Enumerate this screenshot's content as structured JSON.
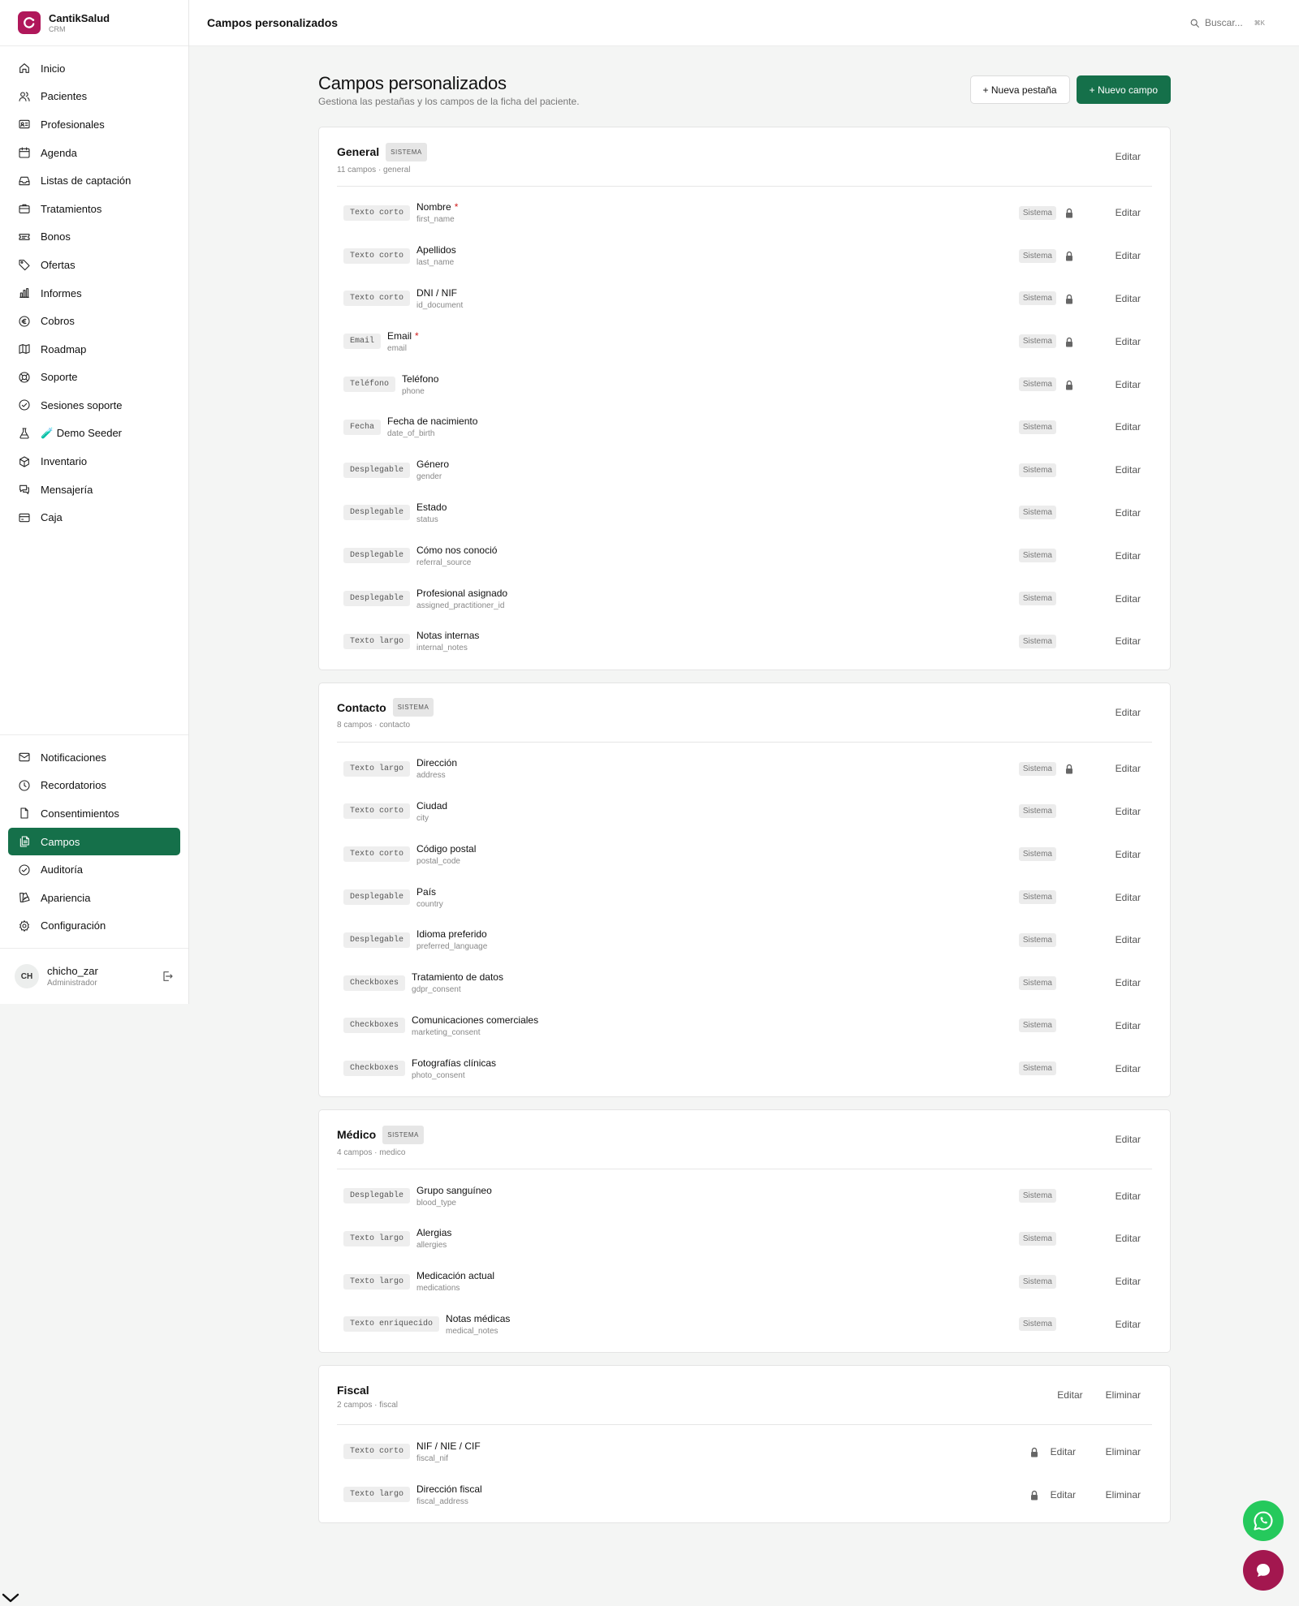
{
  "brand": {
    "name": "CantikSalud",
    "sub": "CRM"
  },
  "nav_main": [
    {
      "id": "inicio",
      "label": "Inicio",
      "icon": "home-icon"
    },
    {
      "id": "pacientes",
      "label": "Pacientes",
      "icon": "users-icon"
    },
    {
      "id": "profesionales",
      "label": "Profesionales",
      "icon": "id-card-icon"
    },
    {
      "id": "agenda",
      "label": "Agenda",
      "icon": "calendar-icon"
    },
    {
      "id": "listas",
      "label": "Listas de captación",
      "icon": "inbox-icon"
    },
    {
      "id": "tratamientos",
      "label": "Tratamientos",
      "icon": "briefcase-icon"
    },
    {
      "id": "bonos",
      "label": "Bonos",
      "icon": "ticket-icon"
    },
    {
      "id": "ofertas",
      "label": "Ofertas",
      "icon": "tag-icon"
    },
    {
      "id": "informes",
      "label": "Informes",
      "icon": "bar-chart-icon"
    },
    {
      "id": "cobros",
      "label": "Cobros",
      "icon": "euro-icon"
    },
    {
      "id": "roadmap",
      "label": "Roadmap",
      "icon": "map-icon"
    },
    {
      "id": "soporte",
      "label": "Soporte",
      "icon": "lifebuoy-icon"
    },
    {
      "id": "sesiones",
      "label": "Sesiones soporte",
      "icon": "shield-check-icon"
    },
    {
      "id": "demo",
      "label": "🧪 Demo Seeder",
      "icon": "flask-icon"
    },
    {
      "id": "inventario",
      "label": "Inventario",
      "icon": "box-icon"
    },
    {
      "id": "mensajeria",
      "label": "Mensajería",
      "icon": "message-icon"
    },
    {
      "id": "caja",
      "label": "Caja",
      "icon": "cash-register-icon"
    }
  ],
  "nav_bottom": [
    {
      "id": "notificaciones",
      "label": "Notificaciones",
      "icon": "mail-icon"
    },
    {
      "id": "recordatorios",
      "label": "Recordatorios",
      "icon": "clock-icon"
    },
    {
      "id": "consentimientos",
      "label": "Consentimientos",
      "icon": "file-icon"
    },
    {
      "id": "campos",
      "label": "Campos",
      "icon": "files-icon",
      "active": true
    },
    {
      "id": "auditoria",
      "label": "Auditoría",
      "icon": "shield-check-icon"
    },
    {
      "id": "apariencia",
      "label": "Apariencia",
      "icon": "palette-icon"
    },
    {
      "id": "configuracion",
      "label": "Configuración",
      "icon": "gear-icon"
    }
  ],
  "user": {
    "initials": "CH",
    "name": "chicho_zar",
    "role": "Administrador"
  },
  "header": {
    "title": "Campos personalizados",
    "search_placeholder": "Buscar...",
    "shortcut": "⌘K"
  },
  "page": {
    "title": "Campos personalizados",
    "subtitle": "Gestiona las pestañas y los campos de la ficha del paciente.",
    "new_tab_button": "+ Nueva pestaña",
    "new_field_button": "+ Nuevo campo"
  },
  "labels": {
    "edit": "Editar",
    "delete": "Eliminar",
    "system_badge": "SISTEMA",
    "system_chip": "Sistema"
  },
  "sections": [
    {
      "title": "General",
      "system": true,
      "meta": "11 campos · general",
      "fields": [
        {
          "type": "Texto corto",
          "label": "Nombre",
          "key": "first_name",
          "required": true,
          "system": true,
          "locked": true
        },
        {
          "type": "Texto corto",
          "label": "Apellidos",
          "key": "last_name",
          "required": false,
          "system": true,
          "locked": true
        },
        {
          "type": "Texto corto",
          "label": "DNI / NIF",
          "key": "id_document",
          "required": false,
          "system": true,
          "locked": true
        },
        {
          "type": "Email",
          "label": "Email",
          "key": "email",
          "required": true,
          "system": true,
          "locked": true
        },
        {
          "type": "Teléfono",
          "label": "Teléfono",
          "key": "phone",
          "required": false,
          "system": true,
          "locked": true
        },
        {
          "type": "Fecha",
          "label": "Fecha de nacimiento",
          "key": "date_of_birth",
          "required": false,
          "system": true,
          "locked": false
        },
        {
          "type": "Desplegable",
          "label": "Género",
          "key": "gender",
          "required": false,
          "system": true,
          "locked": false
        },
        {
          "type": "Desplegable",
          "label": "Estado",
          "key": "status",
          "required": false,
          "system": true,
          "locked": false
        },
        {
          "type": "Desplegable",
          "label": "Cómo nos conoció",
          "key": "referral_source",
          "required": false,
          "system": true,
          "locked": false
        },
        {
          "type": "Desplegable",
          "label": "Profesional asignado",
          "key": "assigned_practitioner_id",
          "required": false,
          "system": true,
          "locked": false
        },
        {
          "type": "Texto largo",
          "label": "Notas internas",
          "key": "internal_notes",
          "required": false,
          "system": true,
          "locked": false
        }
      ]
    },
    {
      "title": "Contacto",
      "system": true,
      "meta": "8 campos · contacto",
      "fields": [
        {
          "type": "Texto largo",
          "label": "Dirección",
          "key": "address",
          "required": false,
          "system": true,
          "locked": true
        },
        {
          "type": "Texto corto",
          "label": "Ciudad",
          "key": "city",
          "required": false,
          "system": true,
          "locked": false
        },
        {
          "type": "Texto corto",
          "label": "Código postal",
          "key": "postal_code",
          "required": false,
          "system": true,
          "locked": false
        },
        {
          "type": "Desplegable",
          "label": "País",
          "key": "country",
          "required": false,
          "system": true,
          "locked": false
        },
        {
          "type": "Desplegable",
          "label": "Idioma preferido",
          "key": "preferred_language",
          "required": false,
          "system": true,
          "locked": false
        },
        {
          "type": "Checkboxes",
          "label": "Tratamiento de datos",
          "key": "gdpr_consent",
          "required": false,
          "system": true,
          "locked": false
        },
        {
          "type": "Checkboxes",
          "label": "Comunicaciones comerciales",
          "key": "marketing_consent",
          "required": false,
          "system": true,
          "locked": false
        },
        {
          "type": "Checkboxes",
          "label": "Fotografías clínicas",
          "key": "photo_consent",
          "required": false,
          "system": true,
          "locked": false
        }
      ]
    },
    {
      "title": "Médico",
      "system": true,
      "meta": "4 campos · medico",
      "fields": [
        {
          "type": "Desplegable",
          "label": "Grupo sanguíneo",
          "key": "blood_type",
          "required": false,
          "system": true,
          "locked": false
        },
        {
          "type": "Texto largo",
          "label": "Alergias",
          "key": "allergies",
          "required": false,
          "system": true,
          "locked": false
        },
        {
          "type": "Texto largo",
          "label": "Medicación actual",
          "key": "medications",
          "required": false,
          "system": true,
          "locked": false
        },
        {
          "type": "Texto enriquecido",
          "label": "Notas médicas",
          "key": "medical_notes",
          "required": false,
          "system": true,
          "locked": false
        }
      ]
    },
    {
      "title": "Fiscal",
      "system": false,
      "meta": "2 campos · fiscal",
      "deletable": true,
      "fields": [
        {
          "type": "Texto corto",
          "label": "NIF / NIE / CIF",
          "key": "fiscal_nif",
          "required": false,
          "system": false,
          "locked": true,
          "deletable": true
        },
        {
          "type": "Texto largo",
          "label": "Dirección fiscal",
          "key": "fiscal_address",
          "required": false,
          "system": false,
          "locked": true,
          "deletable": true
        }
      ]
    }
  ],
  "floating": {
    "whatsapp_icon": "whatsapp-icon",
    "chat_icon": "chat-icon"
  },
  "colors": {
    "primary": "#15704a",
    "brand": "#b0175a",
    "whatsapp": "#25c95c",
    "required": "#d11d1d"
  }
}
